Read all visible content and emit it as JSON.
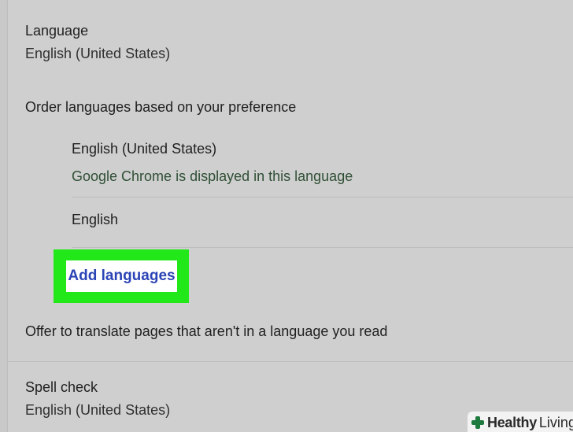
{
  "language_section": {
    "title": "Language",
    "value": "English (United States)"
  },
  "order_section": {
    "heading": "Order languages based on your preference",
    "languages": [
      {
        "name": "English (United States)",
        "note": "Google Chrome is displayed in this language"
      },
      {
        "name": "English",
        "note": ""
      }
    ],
    "add_button_label": "Add languages"
  },
  "translate_offer": "Offer to translate pages that aren't in a language you read",
  "spell_check_section": {
    "title": "Spell check",
    "value": "English (United States)"
  },
  "watermark": {
    "brand": "Healthy",
    "rest": "Living"
  },
  "colors": {
    "highlight": "#22e81a",
    "link_blue": "#2b44b6",
    "note_green": "#2f4f35"
  }
}
